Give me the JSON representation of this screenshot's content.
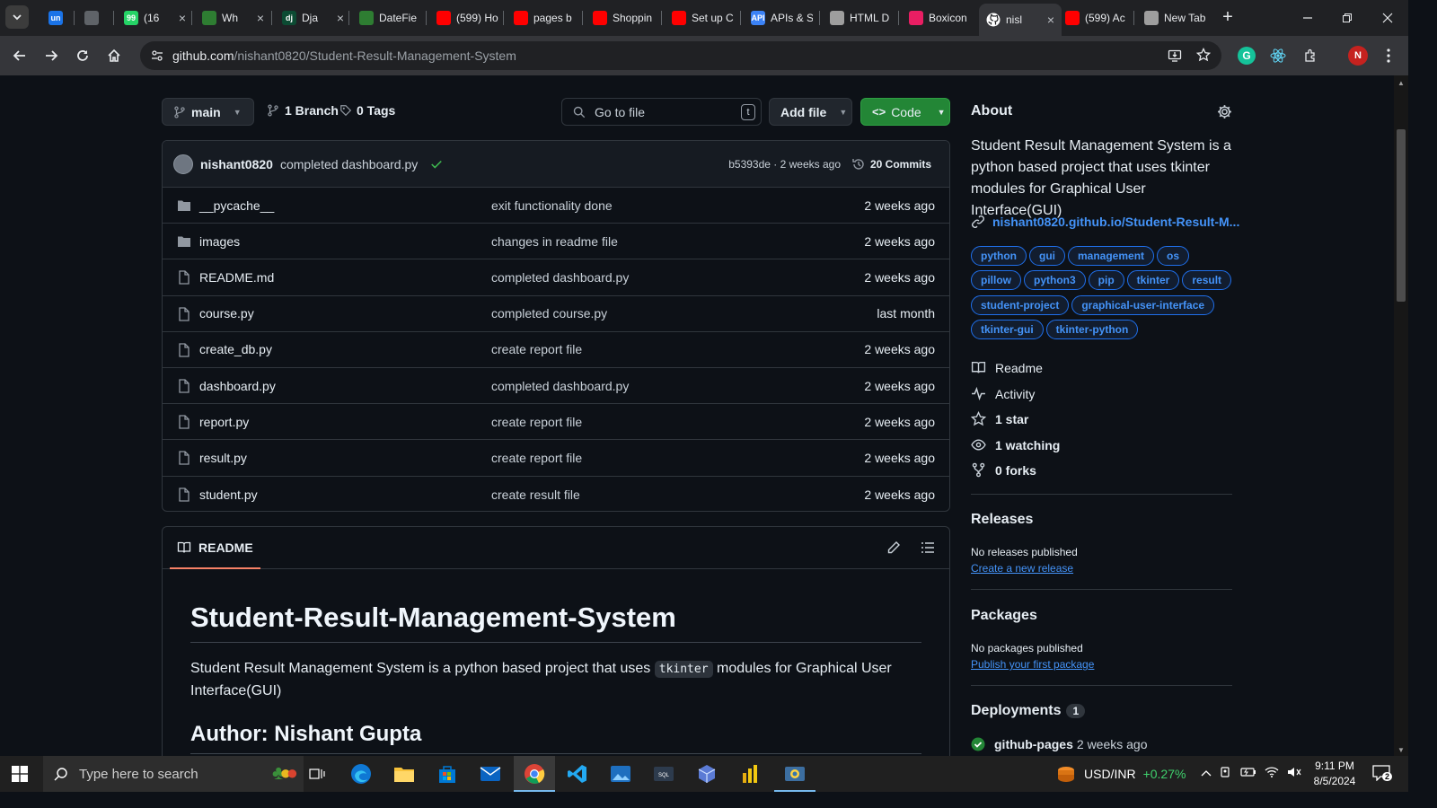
{
  "tabs": [
    {
      "label": "un",
      "color": "#1a73e8"
    },
    {
      "label": "",
      "color": "#5f6368"
    },
    {
      "label": "(16",
      "color": "#25d366"
    },
    {
      "label": "Wh",
      "color": "#2e7d32"
    },
    {
      "label": "Dja",
      "color": "#0c4b33"
    },
    {
      "label": "DateFie",
      "color": "#2e7d32"
    },
    {
      "label": "(599) Ho",
      "color": "#ff0000"
    },
    {
      "label": "pages b",
      "color": "#ff0000"
    },
    {
      "label": "Shoppin",
      "color": "#ff0000"
    },
    {
      "label": "Set up C",
      "color": "#ff0000"
    },
    {
      "label": "APIs & S",
      "color": "#3b82f6"
    },
    {
      "label": "HTML D",
      "color": "#9e9e9e"
    },
    {
      "label": "Boxicon",
      "color": "#e91e63"
    },
    {
      "label": "nisl",
      "color": "#ffffff"
    },
    {
      "label": "(599) Ac",
      "color": "#ff0000"
    },
    {
      "label": "New Tab",
      "color": "#9e9e9e"
    }
  ],
  "tab_fav_text": [
    "un",
    "",
    "99",
    "",
    "dj",
    "",
    "",
    "",
    "",
    "",
    "API",
    "",
    "",
    "",
    "",
    ""
  ],
  "url": {
    "domain": "github.com",
    "path": "/nishant0820/Student-Result-Management-System"
  },
  "repo": {
    "branch": "main",
    "branch_count": "1 Branch",
    "tag_count": "0 Tags",
    "goto_placeholder": "Go to file",
    "goto_key": "t",
    "add_file": "Add file",
    "code": "Code",
    "commit": {
      "author": "nishant0820",
      "message": "completed dashboard.py",
      "hash_time": "b5393de · 2 weeks ago",
      "commits": "20 Commits"
    },
    "files": [
      {
        "name": "__pycache__",
        "type": "folder",
        "message": "exit functionality done",
        "time": "2 weeks ago"
      },
      {
        "name": "images",
        "type": "folder",
        "message": "changes in readme file",
        "time": "2 weeks ago"
      },
      {
        "name": "README.md",
        "type": "file",
        "message": "completed dashboard.py",
        "time": "2 weeks ago"
      },
      {
        "name": "course.py",
        "type": "file",
        "message": "completed course.py",
        "time": "last month"
      },
      {
        "name": "create_db.py",
        "type": "file",
        "message": "create report file",
        "time": "2 weeks ago"
      },
      {
        "name": "dashboard.py",
        "type": "file",
        "message": "completed dashboard.py",
        "time": "2 weeks ago"
      },
      {
        "name": "report.py",
        "type": "file",
        "message": "create report file",
        "time": "2 weeks ago"
      },
      {
        "name": "result.py",
        "type": "file",
        "message": "create report file",
        "time": "2 weeks ago"
      },
      {
        "name": "student.py",
        "type": "file",
        "message": "create result file",
        "time": "2 weeks ago"
      }
    ]
  },
  "readme": {
    "tab": "README",
    "title": "Student-Result-Management-System",
    "desc_before": "Student Result Management System is a python based project that uses",
    "desc_code": "tkinter",
    "desc_after": "modules for Graphical User Interface(GUI)",
    "author": "Author: Nishant Gupta"
  },
  "about": {
    "title": "About",
    "description": "Student Result Management System is a python based project that uses tkinter modules for Graphical User Interface(GUI)",
    "link": "nishant0820.github.io/Student-Result-M...",
    "topics": [
      "python",
      "gui",
      "management",
      "os",
      "pillow",
      "python3",
      "pip",
      "tkinter",
      "result",
      "student-project",
      "graphical-user-interface",
      "tkinter-gui",
      "tkinter-python"
    ],
    "stats": [
      {
        "icon": "book-icon",
        "label": "Readme"
      },
      {
        "icon": "pulse-icon",
        "label": "Activity"
      },
      {
        "icon": "star-icon",
        "label": "1 star"
      },
      {
        "icon": "eye-icon",
        "label": "1 watching"
      },
      {
        "icon": "fork-icon",
        "label": "0 forks"
      }
    ],
    "releases": {
      "title": "Releases",
      "none": "No releases published",
      "link": "Create a new release"
    },
    "packages": {
      "title": "Packages",
      "none": "No packages published",
      "link": "Publish your first package"
    },
    "deployments": {
      "title": "Deployments",
      "count": "1",
      "name": "github-pages",
      "time": "2 weeks ago"
    }
  },
  "taskbar": {
    "search_placeholder": "Type here to search",
    "ticker": "USD/INR",
    "change": "+0.27%",
    "time": "9:11 PM",
    "date": "8/5/2024",
    "notif_count": "2"
  },
  "colors": {
    "accent": "#238636",
    "link": "#4493f8",
    "bg": "#0d1117"
  }
}
